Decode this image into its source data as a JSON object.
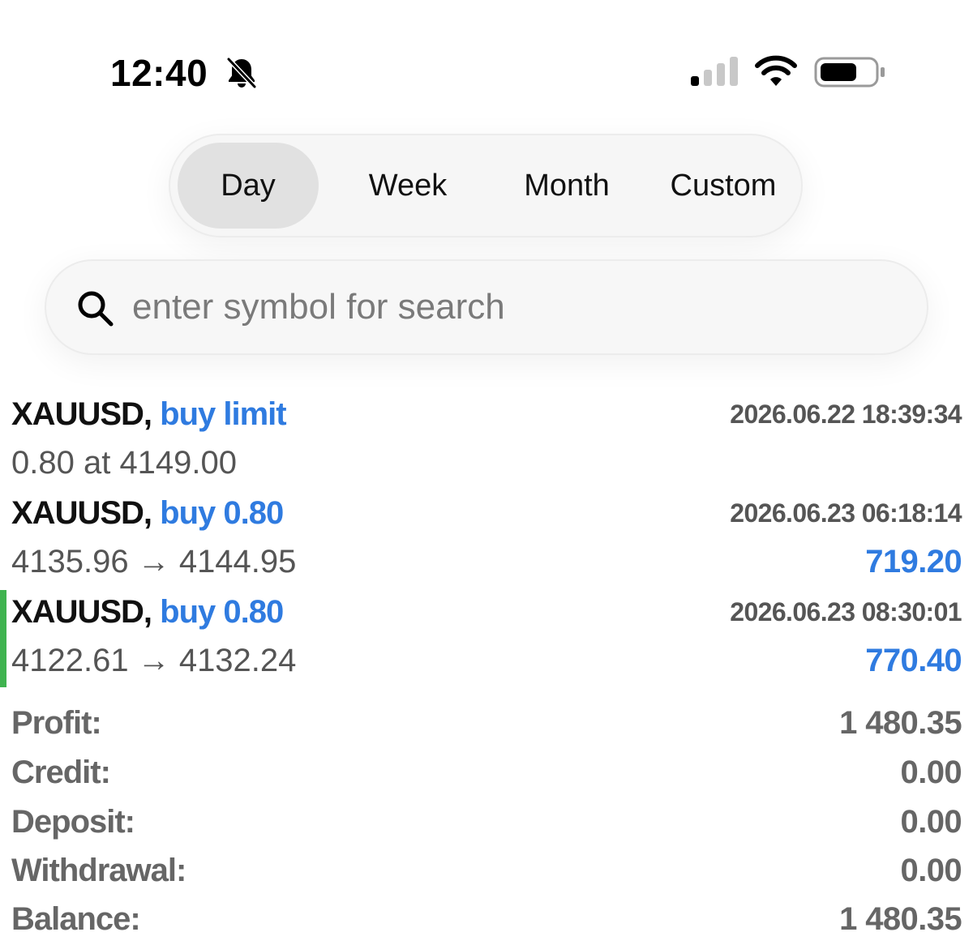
{
  "status_bar": {
    "time": "12:40",
    "icons": [
      "bell-muted-icon",
      "cellular-signal-icon",
      "wifi-icon",
      "battery-icon"
    ]
  },
  "period_tabs": [
    {
      "label": "Day",
      "active": true
    },
    {
      "label": "Week",
      "active": false
    },
    {
      "label": "Month",
      "active": false
    },
    {
      "label": "Custom",
      "active": false
    }
  ],
  "search": {
    "placeholder": "enter symbol for search",
    "value": ""
  },
  "trades": [
    {
      "symbol": "XAUUSD,",
      "type": "buy limit",
      "time": "2026.06.22 18:39:34",
      "detail": "0.80 at 4149.00",
      "profit": ""
    },
    {
      "symbol": "XAUUSD,",
      "type": "buy 0.80",
      "time": "2026.06.23 06:18:14",
      "detail": "4135.96 → 4144.95",
      "profit": "719.20"
    },
    {
      "symbol": "XAUUSD,",
      "type": "buy 0.80",
      "time": "2026.06.23 08:30:01",
      "detail": "4122.61 → 4132.24",
      "profit": "770.40"
    }
  ],
  "summary": [
    {
      "label": "Profit:",
      "value": "1 480.35"
    },
    {
      "label": "Credit:",
      "value": "0.00"
    },
    {
      "label": "Deposit:",
      "value": "0.00"
    },
    {
      "label": "Withdrawal:",
      "value": "0.00"
    },
    {
      "label": "Balance:",
      "value": "1 480.35"
    }
  ],
  "colors": {
    "accent_blue": "#2f7be0",
    "selected_marker_green": "#3fb34f",
    "segment_active_bg": "#e1e1e1",
    "muted_text": "#666666"
  }
}
